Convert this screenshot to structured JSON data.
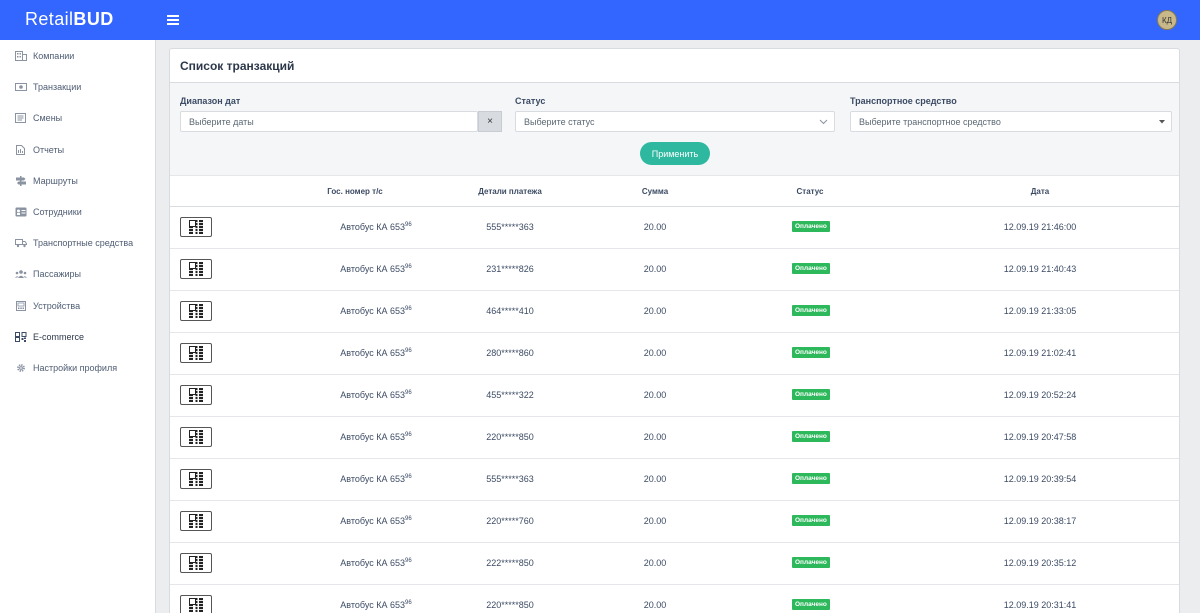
{
  "brand": {
    "light": "Retail",
    "bold": "BUD"
  },
  "user": {
    "initials": "КД"
  },
  "sidebar": {
    "items": [
      {
        "label": "Компании",
        "icon": "building-icon"
      },
      {
        "label": "Транзакции",
        "icon": "money-icon"
      },
      {
        "label": "Смены",
        "icon": "list-icon"
      },
      {
        "label": "Отчеты",
        "icon": "report-icon"
      },
      {
        "label": "Маршруты",
        "icon": "signpost-icon"
      },
      {
        "label": "Сотрудники",
        "icon": "id-card-icon"
      },
      {
        "label": "Транспортные средства",
        "icon": "truck-icon"
      },
      {
        "label": "Пассажиры",
        "icon": "users-icon"
      },
      {
        "label": "Устройства",
        "icon": "device-icon"
      },
      {
        "label": "E-commerce",
        "icon": "qr-icon"
      },
      {
        "label": "Настройки профиля",
        "icon": "gear-icon"
      }
    ]
  },
  "page": {
    "title": "Список транзакций"
  },
  "filters": {
    "date_label": "Диапазон дат",
    "date_placeholder": "Выберите даты",
    "clear": "×",
    "status_label": "Статус",
    "status_placeholder": "Выберите статус",
    "vehicle_label": "Транспортное средство",
    "vehicle_placeholder": "Выберите транспортное средство",
    "apply": "Применить"
  },
  "table": {
    "columns": [
      "Гос. номер т/с",
      "Детали платежа",
      "Сумма",
      "Статус",
      "Дата"
    ],
    "rows": [
      {
        "plate": "Автобус КА 653",
        "sup": "96",
        "payment": "555*****363",
        "amount": "20.00",
        "status": "Оплачено",
        "date": "12.09.19 21:46:00"
      },
      {
        "plate": "Автобус КА 653",
        "sup": "96",
        "payment": "231*****826",
        "amount": "20.00",
        "status": "Оплачено",
        "date": "12.09.19 21:40:43"
      },
      {
        "plate": "Автобус КА 653",
        "sup": "96",
        "payment": "464*****410",
        "amount": "20.00",
        "status": "Оплачено",
        "date": "12.09.19 21:33:05"
      },
      {
        "plate": "Автобус КА 653",
        "sup": "96",
        "payment": "280*****860",
        "amount": "20.00",
        "status": "Оплачено",
        "date": "12.09.19 21:02:41"
      },
      {
        "plate": "Автобус КА 653",
        "sup": "96",
        "payment": "455*****322",
        "amount": "20.00",
        "status": "Оплачено",
        "date": "12.09.19 20:52:24"
      },
      {
        "plate": "Автобус КА 653",
        "sup": "96",
        "payment": "220*****850",
        "amount": "20.00",
        "status": "Оплачено",
        "date": "12.09.19 20:47:58"
      },
      {
        "plate": "Автобус КА 653",
        "sup": "96",
        "payment": "555*****363",
        "amount": "20.00",
        "status": "Оплачено",
        "date": "12.09.19 20:39:54"
      },
      {
        "plate": "Автобус КА 653",
        "sup": "96",
        "payment": "220*****760",
        "amount": "20.00",
        "status": "Оплачено",
        "date": "12.09.19 20:38:17"
      },
      {
        "plate": "Автобус КА 653",
        "sup": "96",
        "payment": "222*****850",
        "amount": "20.00",
        "status": "Оплачено",
        "date": "12.09.19 20:35:12"
      },
      {
        "plate": "Автобус КА 653",
        "sup": "96",
        "payment": "220*****850",
        "amount": "20.00",
        "status": "Оплачено",
        "date": "12.09.19 20:31:41"
      }
    ]
  },
  "colors": {
    "topbar": "#3366ff",
    "accent": "#2eb8a0",
    "paid": "#2eb85c"
  }
}
